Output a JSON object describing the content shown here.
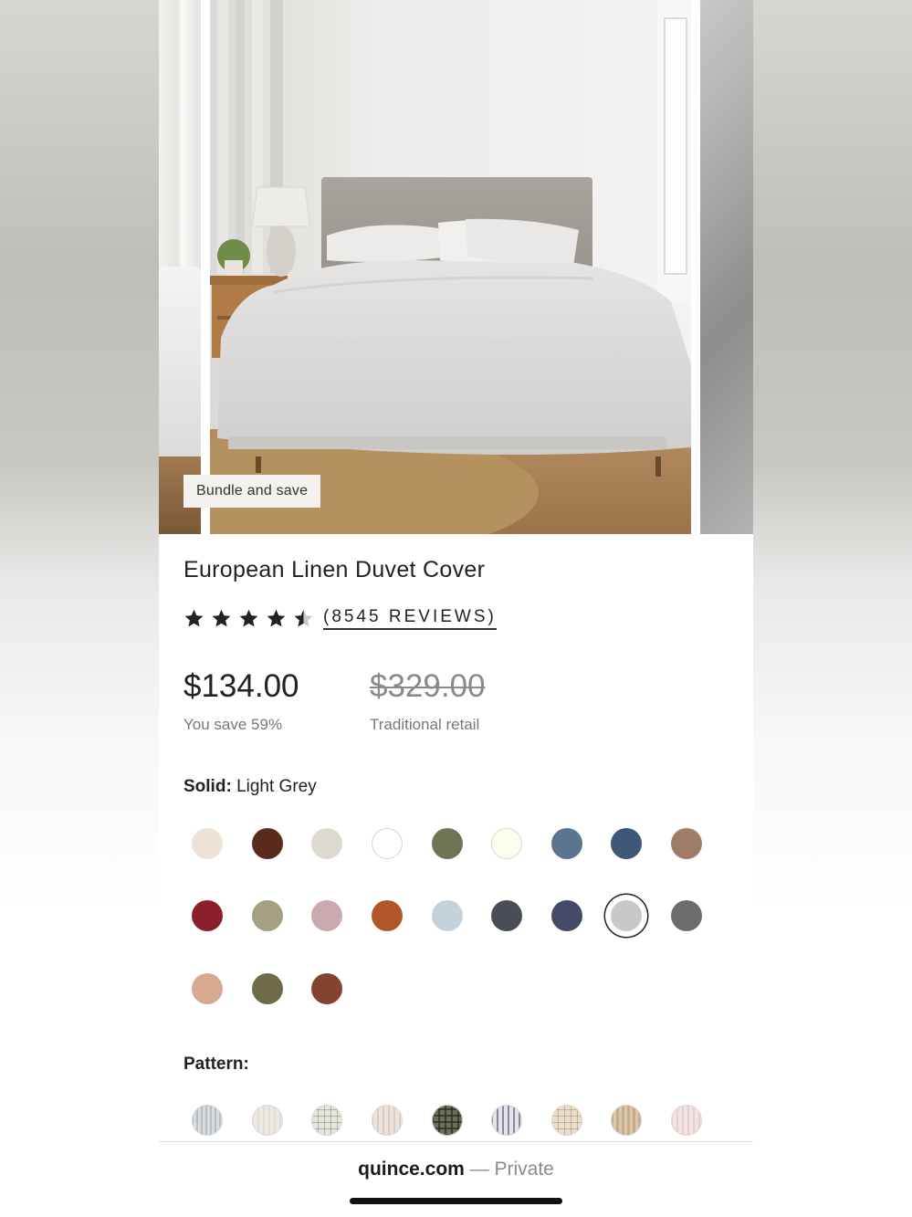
{
  "gallery": {
    "badge": "Bundle and save"
  },
  "product": {
    "title": "European Linen Duvet Cover",
    "rating": 4.5,
    "reviews_label": "(8545 REVIEWS)",
    "price": "$134.00",
    "savings": "You save 59%",
    "retail_price": "$329.00",
    "retail_label": "Traditional retail"
  },
  "solid": {
    "label": "Solid:",
    "selected": "Light Grey",
    "swatches": [
      {
        "color": "#ece2d6"
      },
      {
        "color": "#5a2a1c"
      },
      {
        "color": "#dedad0"
      },
      {
        "color": "#ffffff"
      },
      {
        "color": "#727456"
      },
      {
        "color": "#fdfdee"
      },
      {
        "color": "#5b7490"
      },
      {
        "color": "#3f5777"
      },
      {
        "color": "#a07c66"
      },
      {
        "color": "#8b1f2a"
      },
      {
        "color": "#a3a084"
      },
      {
        "color": "#c9a9ae"
      },
      {
        "color": "#b1562a"
      },
      {
        "color": "#c4d2d9"
      },
      {
        "color": "#4b4d55"
      },
      {
        "color": "#454a66"
      },
      {
        "color": "#c6c8ca"
      },
      {
        "color": "#6a6c6e"
      },
      {
        "color": "#d6a98e"
      },
      {
        "color": "#6d6b48"
      },
      {
        "color": "#834330"
      }
    ]
  },
  "pattern": {
    "label": "Pattern:",
    "swatches": [
      {
        "color": "#d9dcde"
      },
      {
        "color": "#ece9e2"
      },
      {
        "color": "#e6e6de"
      },
      {
        "color": "#ece3dc"
      },
      {
        "color": "#6b6f58"
      },
      {
        "color": "#e6e2ea"
      },
      {
        "color": "#ebdfcf"
      },
      {
        "color": "#dcc7ad"
      },
      {
        "color": "#f1e3e2"
      }
    ]
  },
  "browser": {
    "domain": "quince.com",
    "separator": " — ",
    "mode": "Private"
  }
}
